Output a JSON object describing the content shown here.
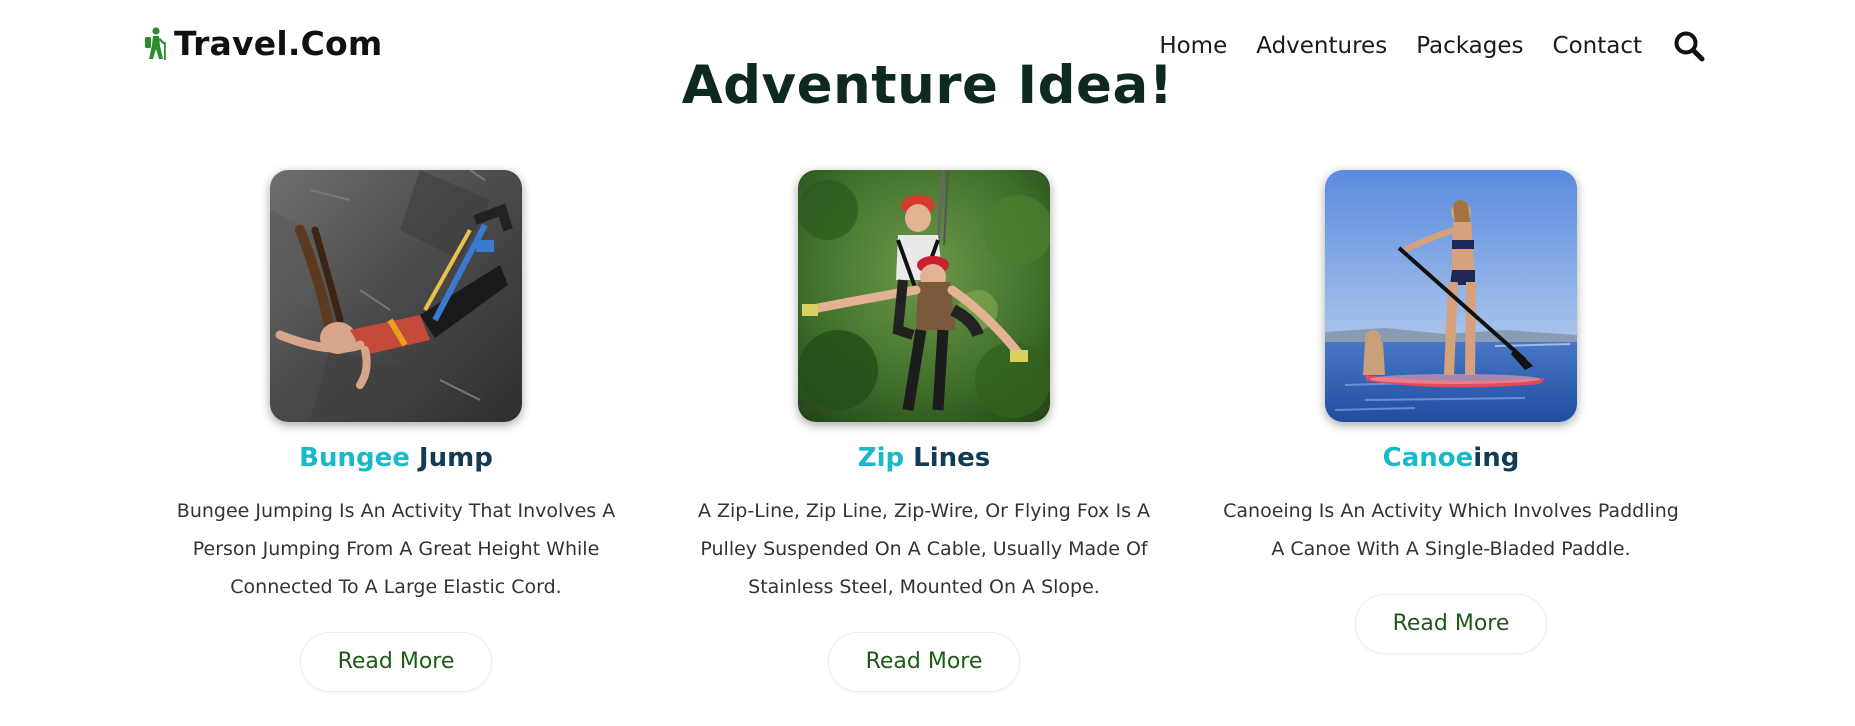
{
  "brand": {
    "name": "Travel.Com",
    "icon": "hiker-icon",
    "accent": "#2e8b2e"
  },
  "nav": {
    "items": [
      {
        "label": "Home"
      },
      {
        "label": "Adventures"
      },
      {
        "label": "Packages"
      },
      {
        "label": "Contact"
      }
    ],
    "search_icon": "search-icon"
  },
  "section": {
    "title": "Adventure Idea!"
  },
  "cards": [
    {
      "title_part1": "Bungee",
      "title_part2": " Jump",
      "description": "Bungee Jumping Is An Activity That Involves A Person Jumping From A Great Height While Connected To A Large Elastic Cord.",
      "button": "Read More",
      "image": "bungee-jump-photo"
    },
    {
      "title_part1": "Zip",
      "title_part2": " Lines",
      "description": "A Zip-Line, Zip Line, Zip-Wire, Or Flying Fox Is A Pulley Suspended On A Cable, Usually Made Of Stainless Steel, Mounted On A Slope.",
      "button": "Read More",
      "image": "zip-line-photo"
    },
    {
      "title_part1": "Canoe",
      "title_part2": "ing",
      "description": "Canoeing Is An Activity Which Involves Paddling A Canoe With A Single-Bladed Paddle.",
      "button": "Read More",
      "image": "canoeing-photo"
    }
  ],
  "colors": {
    "title_primary": "#19b9c9",
    "title_secondary": "#123c55",
    "button_text": "#1f5a18",
    "heading": "#0e2a20"
  }
}
